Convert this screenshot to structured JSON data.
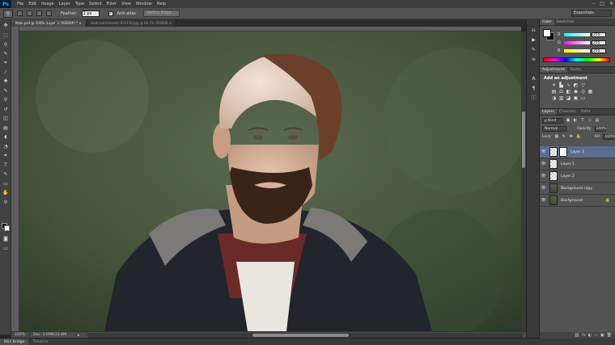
{
  "app": {
    "logo": "Ps",
    "menu": [
      "File",
      "Edit",
      "Image",
      "Layer",
      "Type",
      "Select",
      "Filter",
      "View",
      "Window",
      "Help"
    ],
    "window_controls": [
      "–",
      "□",
      "✕"
    ]
  },
  "options": {
    "tool_icon": "lasso-icon",
    "feather_label": "Feather:",
    "feather_value": "2 px",
    "antialias_label": "Anti-alias",
    "antialias_checked": "✓",
    "refine_edge": "Refine Edge...",
    "workspace": "Essentials"
  },
  "tabs": [
    {
      "label": "Main.psd @ 200% (Layer 3, RGB/8#) *  ×",
      "active": true
    },
    {
      "label": "adult-bald-beauty-952130.jpg @ 66.7% (RGB/8)  ×",
      "active": false
    }
  ],
  "status": {
    "zoom": "200%",
    "doc": "Doc: 3.09M/21.6M",
    "arrow": "▸"
  },
  "bottom_tabs": [
    {
      "label": "Mini Bridge",
      "active": true
    },
    {
      "label": "Timeline",
      "active": false
    }
  ],
  "color_panel": {
    "tabs": [
      "Color",
      "Swatches"
    ],
    "rows": [
      {
        "label": "R",
        "value": "255"
      },
      {
        "label": "G",
        "value": "255"
      },
      {
        "label": "B",
        "value": "255"
      }
    ]
  },
  "adjustments": {
    "tabs": [
      "Adjustments",
      "Styles"
    ],
    "title": "Add an adjustment"
  },
  "layers_panel": {
    "tabs": [
      "Layers",
      "Channels",
      "Paths"
    ],
    "kind": "ρ Kind",
    "blend": "Normal",
    "opacity_label": "Opacity:",
    "opacity": "100%",
    "lock_label": "Lock:",
    "fill_label": "Fill:",
    "fill": "100%",
    "layers": [
      {
        "name": "Layer 3",
        "selected": true,
        "mask": true,
        "photo": false,
        "lock": ""
      },
      {
        "name": "Layer 1",
        "selected": false,
        "mask": false,
        "photo": false,
        "lock": ""
      },
      {
        "name": "Layer 2",
        "selected": false,
        "mask": false,
        "photo": false,
        "lock": ""
      },
      {
        "name": "Background copy",
        "selected": false,
        "mask": false,
        "photo": true,
        "lock": ""
      },
      {
        "name": "Background",
        "selected": false,
        "mask": false,
        "photo": true,
        "lock": "🔒",
        "italic": true
      }
    ],
    "footer_icons": [
      "⛓",
      "fx",
      "◐",
      "▭",
      "▣",
      "🗑"
    ]
  },
  "colors": {
    "selected_layer": "#5b6d8f",
    "canvas_bg": "#3c4a38"
  }
}
